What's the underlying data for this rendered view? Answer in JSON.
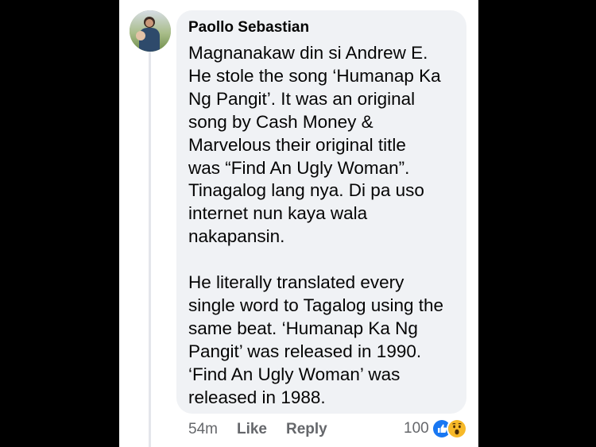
{
  "comment": {
    "author": "Paollo Sebastian",
    "paragraphs": [
      [
        "Magnanakaw din si Andrew E.",
        "He stole the song ‘Humanap Ka",
        "Ng Pangit’. It was an original",
        "song by Cash Money &",
        "Marvelous their original title",
        "was “Find An Ugly Woman”.",
        "Tinagalog lang nya. Di pa uso",
        "internet nun kaya wala",
        "nakapansin."
      ],
      [
        "He literally translated every",
        "single word to Tagalog using the",
        "same beat. ‘Humanap Ka Ng",
        "Pangit’ was released in 1990.",
        "‘Find An Ugly Woman’ was",
        "released in 1988."
      ]
    ]
  },
  "actions": {
    "time": "54m",
    "like": "Like",
    "reply": "Reply"
  },
  "reactions": {
    "count": "100",
    "icons": [
      "like-reaction-icon",
      "wow-reaction-icon"
    ],
    "like_color": "#1877f2",
    "wow_color": "#f7b928"
  }
}
